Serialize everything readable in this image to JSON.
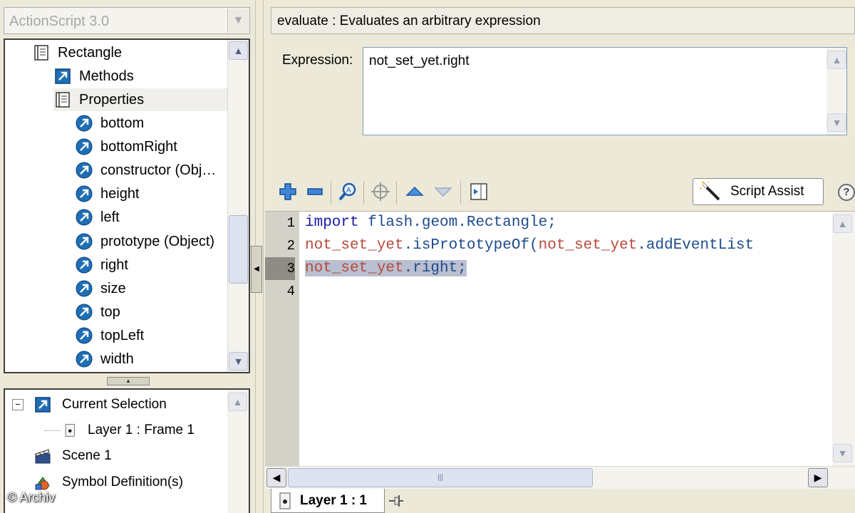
{
  "left_panel": {
    "language_select": {
      "value": "ActionScript 3.0"
    },
    "tree": {
      "items": [
        {
          "label": "Rectangle",
          "icon": "class-book-icon"
        },
        {
          "label": "Methods",
          "icon": "methods-icon"
        },
        {
          "label": "Properties",
          "icon": "properties-book-icon"
        },
        {
          "label": "bottom",
          "icon": "property-icon"
        },
        {
          "label": "bottomRight",
          "icon": "property-icon"
        },
        {
          "label": "constructor (Obj…",
          "icon": "property-icon"
        },
        {
          "label": "height",
          "icon": "property-icon"
        },
        {
          "label": "left",
          "icon": "property-icon"
        },
        {
          "label": "prototype (Object)",
          "icon": "property-icon"
        },
        {
          "label": "right",
          "icon": "property-icon"
        },
        {
          "label": "size",
          "icon": "property-icon"
        },
        {
          "label": "top",
          "icon": "property-icon"
        },
        {
          "label": "topLeft",
          "icon": "property-icon"
        },
        {
          "label": "width",
          "icon": "property-icon"
        }
      ]
    },
    "navigator": {
      "items": [
        {
          "label": "Current Selection",
          "icon": "current-selection-icon",
          "expander": "⊟"
        },
        {
          "label": "Layer 1 : Frame 1",
          "icon": "frame-icon"
        },
        {
          "label": "Scene 1",
          "icon": "scene-clapper-icon"
        },
        {
          "label": "Symbol Definition(s)",
          "icon": "symbol-definitions-icon"
        }
      ]
    }
  },
  "right_panel": {
    "header": "evaluate : Evaluates an arbitrary expression",
    "expression": {
      "label": "Expression:",
      "value": "not_set_yet.right"
    },
    "toolbar": {
      "script_assist_label": "Script Assist",
      "help_label": "?"
    },
    "editor": {
      "line_numbers": [
        "1",
        "2",
        "3",
        "4"
      ],
      "current_line": 3,
      "lines": [
        {
          "parts": [
            {
              "t": "import",
              "c": "kw"
            },
            {
              "t": " flash.geom.Rectangle;",
              "c": "id"
            }
          ]
        },
        {
          "parts": [
            {
              "t": "not_set_yet",
              "c": "red"
            },
            {
              "t": ".isPrototypeOf(",
              "c": "id"
            },
            {
              "t": "not_set_yet",
              "c": "red"
            },
            {
              "t": ".addEventList",
              "c": "id"
            }
          ]
        },
        {
          "parts": [
            {
              "t": "not_set_yet",
              "c": "red"
            },
            {
              "t": ".right;",
              "c": "id"
            }
          ],
          "selected": true
        },
        {
          "parts": []
        }
      ]
    },
    "tab": {
      "label": "Layer 1 : 1"
    }
  },
  "watermark": "© Archiv",
  "colors": {
    "panel_bg": "#ece9d8",
    "gutter": "#d3d1c8",
    "selection": "#b9bfcf",
    "keyword": "#1a1aa6",
    "identifier_red": "#b74a3a"
  }
}
